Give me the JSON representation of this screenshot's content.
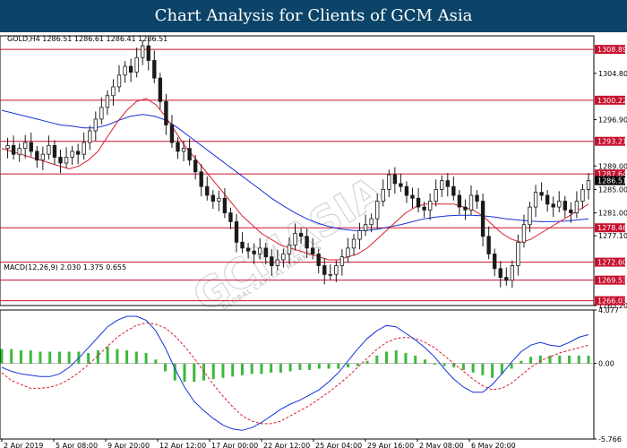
{
  "banner": {
    "title": "Chart Analysis for Clients of GCM Asia"
  },
  "watermark": {
    "brand": "GCMASIA",
    "tagline": "GLOBAL CAPITAL MARKETS"
  },
  "chart_data": [
    {
      "type": "candlestick",
      "header": "GOLD,H4  1286.51 1286.61 1286.41 1286.51",
      "symbol": "GOLD,H4",
      "last_price": 1286.51,
      "ylim": [
        1265.2,
        1311.2
      ],
      "y_ticks": [
        "1304.80",
        "1296.90",
        "1289.00",
        "1285.00",
        "1281.00",
        "1277.10",
        "1265.20"
      ],
      "x_ticks": [
        "2 Apr 2019",
        "5 Apr 08:00",
        "9 Apr 20:00",
        "12 Apr 12:00",
        "17 Apr 00:00",
        "22 Apr 12:00",
        "25 Apr 04:00",
        "29 Apr 16:00",
        "2 May 08:00",
        "6 May 20:00"
      ],
      "levels": [
        {
          "value": 1308.89,
          "label": "1308.89",
          "color": "#c8102e"
        },
        {
          "value": 1300.22,
          "label": "1300.22",
          "color": "#c8102e"
        },
        {
          "value": 1293.21,
          "label": "1293.21",
          "color": "#c8102e"
        },
        {
          "value": 1287.64,
          "label": "1287.64",
          "color": "#c8102e"
        },
        {
          "value": 1278.46,
          "label": "1278.46",
          "color": "#c8102e"
        },
        {
          "value": 1272.6,
          "label": "1272.60",
          "color": "#c8102e"
        },
        {
          "value": 1269.53,
          "label": "1269.53",
          "color": "#c8102e"
        },
        {
          "value": 1266.03,
          "label": "1266.03",
          "color": "#c8102e"
        }
      ],
      "price_path": [
        1292,
        1292.5,
        1291,
        1292,
        1293,
        1291.5,
        1290,
        1291,
        1292.5,
        1290.5,
        1289.5,
        1290.5,
        1291.5,
        1291,
        1293,
        1295,
        1297,
        1299,
        1301,
        1302.5,
        1304.5,
        1306,
        1305,
        1307.5,
        1309.5,
        1307,
        1304,
        1300,
        1296,
        1293,
        1291.5,
        1292,
        1290,
        1288,
        1285.5,
        1284,
        1283,
        1283.5,
        1281,
        1279.5,
        1276,
        1275,
        1274.5,
        1274,
        1275,
        1273.5,
        1272,
        1273,
        1274,
        1275.5,
        1277.5,
        1277,
        1275,
        1274,
        1272,
        1270.5,
        1270.5,
        1272,
        1273.5,
        1275,
        1276.5,
        1278,
        1279,
        1280,
        1283,
        1285,
        1287.5,
        1286,
        1285.5,
        1284,
        1283.5,
        1282,
        1281.5,
        1283,
        1285,
        1286.5,
        1285.5,
        1284,
        1282,
        1281.5,
        1284,
        1283,
        1277,
        1274,
        1271.5,
        1270,
        1269.5,
        1272,
        1276,
        1279,
        1282,
        1284.5,
        1284,
        1282.5,
        1282,
        1283,
        1281.5,
        1281,
        1283,
        1285,
        1286.5
      ],
      "ma_fast": [
        1292,
        1291.5,
        1291,
        1290.5,
        1290,
        1289.5,
        1289,
        1288.5,
        1289,
        1290,
        1291.5,
        1294,
        1296.5,
        1298.5,
        1300,
        1300.5,
        1299.5,
        1297.5,
        1295,
        1292.5,
        1290.5,
        1288.5,
        1286.5,
        1284.5,
        1282.5,
        1280.5,
        1279,
        1277.5,
        1276.5,
        1275.5,
        1275,
        1274.5,
        1274,
        1273.5,
        1273,
        1273,
        1273.5,
        1274,
        1275,
        1276.5,
        1278,
        1279.5,
        1281,
        1282,
        1282.5,
        1282.5,
        1282.5,
        1282.5,
        1282,
        1281.5,
        1280.5,
        1279,
        1277.5,
        1276.5,
        1276,
        1276.5,
        1277.5,
        1278.5,
        1279.5,
        1280.5,
        1281.5,
        1282.5
      ],
      "ma_slow": [
        1298.5,
        1298,
        1297.5,
        1297,
        1296.5,
        1296,
        1295.8,
        1295.5,
        1295.5,
        1296,
        1296.8,
        1297.5,
        1297.8,
        1297.5,
        1296.8,
        1295.5,
        1294,
        1292.5,
        1291,
        1289.5,
        1288,
        1286.5,
        1285,
        1283.5,
        1282.2,
        1281,
        1280,
        1279.2,
        1278.6,
        1278.2,
        1278,
        1278,
        1278.2,
        1278.6,
        1279,
        1279.5,
        1280,
        1280.3,
        1280.5,
        1280.6,
        1280.6,
        1280.5,
        1280.3,
        1280,
        1279.8,
        1279.6,
        1279.5,
        1279.5,
        1279.6,
        1279.8,
        1280
      ],
      "price_color": "#1a1a1a",
      "ma_fast_color": "#d81e2c",
      "ma_slow_color": "#1432d8"
    },
    {
      "type": "line+bar",
      "header": "MACD(12,26,9) 2.030 1.375 0.655",
      "ylim": [
        -5.766,
        4.077
      ],
      "y_ticks": [
        "4.077",
        "0.00",
        "-5.766"
      ],
      "series": [
        {
          "name": "MACD(12,26,9)",
          "kind": "line",
          "color": "#1432d8",
          "values": [
            -0.3,
            -0.6,
            -0.8,
            -0.9,
            -1.0,
            -1.0,
            -0.8,
            -0.3,
            0.4,
            1.2,
            2.0,
            2.8,
            3.3,
            3.6,
            3.6,
            3.3,
            2.5,
            1.2,
            -0.4,
            -1.8,
            -2.9,
            -3.6,
            -4.2,
            -4.7,
            -5.0,
            -5.1,
            -4.9,
            -4.5,
            -4.0,
            -3.5,
            -3.1,
            -2.8,
            -2.4,
            -2.0,
            -1.4,
            -0.7,
            0.2,
            1.1,
            1.9,
            2.5,
            2.9,
            2.8,
            2.3,
            1.8,
            1.2,
            0.5,
            -0.4,
            -1.2,
            -1.8,
            -2.2,
            -2.2,
            -1.6,
            -0.8,
            0.1,
            0.9,
            1.4,
            1.6,
            1.4,
            1.3,
            1.6,
            2.0,
            2.2
          ]
        },
        {
          "name": "Signal",
          "kind": "line-dashed",
          "color": "#d81e2c",
          "values": [
            -0.7,
            -1.3,
            -1.6,
            -1.9,
            -1.9,
            -1.8,
            -1.6,
            -1.2,
            -0.7,
            -0.1,
            0.6,
            1.3,
            2.0,
            2.5,
            2.9,
            3.1,
            3.0,
            2.7,
            2.1,
            1.3,
            0.4,
            -0.6,
            -1.6,
            -2.5,
            -3.3,
            -4.0,
            -4.4,
            -4.6,
            -4.6,
            -4.4,
            -4.0,
            -3.6,
            -3.2,
            -2.7,
            -2.2,
            -1.6,
            -1.0,
            -0.3,
            0.4,
            1.1,
            1.6,
            1.9,
            2.0,
            1.9,
            1.6,
            1.2,
            0.6,
            0.0,
            -0.6,
            -1.2,
            -1.7,
            -2.0,
            -1.9,
            -1.5,
            -0.9,
            -0.3,
            0.2,
            0.5,
            0.8,
            1.0,
            1.2,
            1.4
          ]
        },
        {
          "name": "Histogram",
          "kind": "bar",
          "color": "#3cb83c",
          "values": [
            1.1,
            1.1,
            1.0,
            1.0,
            0.9,
            0.9,
            0.9,
            0.9,
            0.9,
            0.8,
            1.0,
            1.3,
            1.1,
            1.0,
            0.9,
            0.8,
            0.3,
            -0.6,
            -1.3,
            -1.4,
            -1.4,
            -1.3,
            -1.2,
            -1.1,
            -1.0,
            -0.9,
            -0.8,
            -0.8,
            -0.7,
            -0.7,
            -0.6,
            -0.5,
            -0.5,
            -0.4,
            -0.4,
            -0.4,
            -0.3,
            -0.2,
            0.2,
            0.6,
            0.9,
            1.0,
            0.8,
            0.6,
            0.3,
            -0.1,
            -0.2,
            -0.3,
            -0.5,
            -0.7,
            -0.9,
            -1.1,
            -0.8,
            -0.4,
            0.2,
            0.5,
            0.6,
            0.6,
            0.6,
            0.6,
            0.6,
            0.6
          ]
        }
      ]
    }
  ]
}
